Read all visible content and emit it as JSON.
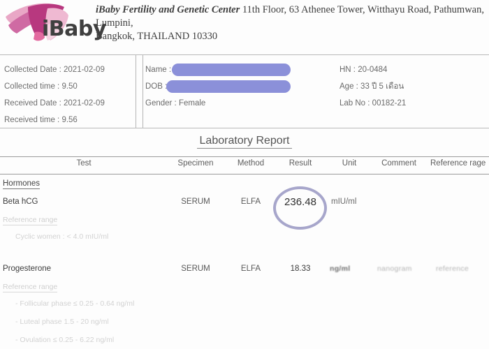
{
  "clinic": {
    "name": "iBaby Fertility and Genetic Center",
    "address": "11th Floor, 63 Athenee Tower, Witthayu Road, Pathumwan, Lumpini,",
    "address_line2": "Bangkok, THAILAND 10330",
    "logo_text": "iBaby",
    "logo_colors": {
      "hair": "#c0488f",
      "face": "#efb8cf",
      "accent": "#e98fb8",
      "text": "#3f3f3f"
    }
  },
  "patient_info": {
    "left": [
      {
        "label": "Collected Date",
        "value": "2021-02-09",
        "text": "Collected Date : 2021-02-09"
      },
      {
        "label": "Collected time",
        "value": "9.50",
        "text": "Collected time : 9.50"
      },
      {
        "label": "Received Date",
        "value": "2021-02-09",
        "text": "Received Date : 2021-02-09"
      },
      {
        "label": "Received time",
        "value": "9.56",
        "text": "Received time : 9.56"
      }
    ],
    "middle": [
      {
        "label": "Name :",
        "value": "",
        "redacted": true
      },
      {
        "label": "DOB :",
        "value": "",
        "redacted": true
      },
      {
        "label": "Gender : Female",
        "value": "Female",
        "redacted": false
      }
    ],
    "right": [
      {
        "label": "HN",
        "value": "20-0484",
        "text": "HN : 20-0484"
      },
      {
        "label": "Age",
        "value": "33 ปี 5 เดือน",
        "text": "Age : 33 ปี 5 เดือน"
      },
      {
        "label": "Lab No",
        "value": "00182-21",
        "text": "Lab No : 00182-21"
      }
    ],
    "redaction_color": "#8b90d9"
  },
  "report": {
    "title": "Laboratory Report",
    "columns": {
      "test": "Test",
      "specimen": "Specimen",
      "method": "Method",
      "result": "Result",
      "unit": "Unit",
      "comment": "Comment",
      "reference": "Reference rage"
    },
    "group": "Hormones",
    "reference_label": "Reference range",
    "highlight_color": "#9b9ac4",
    "tests": [
      {
        "name": "Beta hCG",
        "specimen": "SERUM",
        "method": "ELFA",
        "result": "236.48",
        "unit": "mIU/ml",
        "highlighted": true,
        "reference_lines": [
          "Cyclic women : < 4.0 mIU/ml"
        ]
      },
      {
        "name": "Progesterone",
        "specimen": "SERUM",
        "method": "ELFA",
        "result": "18.33",
        "unit": "ng/ml",
        "highlighted": false,
        "smudged_text": [
          "ng/ml",
          "nanogram",
          "reference"
        ],
        "reference_lines": [
          "- Follicular phase ≤ 0.25 - 0.64 ng/ml",
          "- Luteal phase 1.5 - 20 ng/ml",
          "- Ovulation ≤ 0.25 - 6.22 ng/ml"
        ]
      }
    ]
  }
}
